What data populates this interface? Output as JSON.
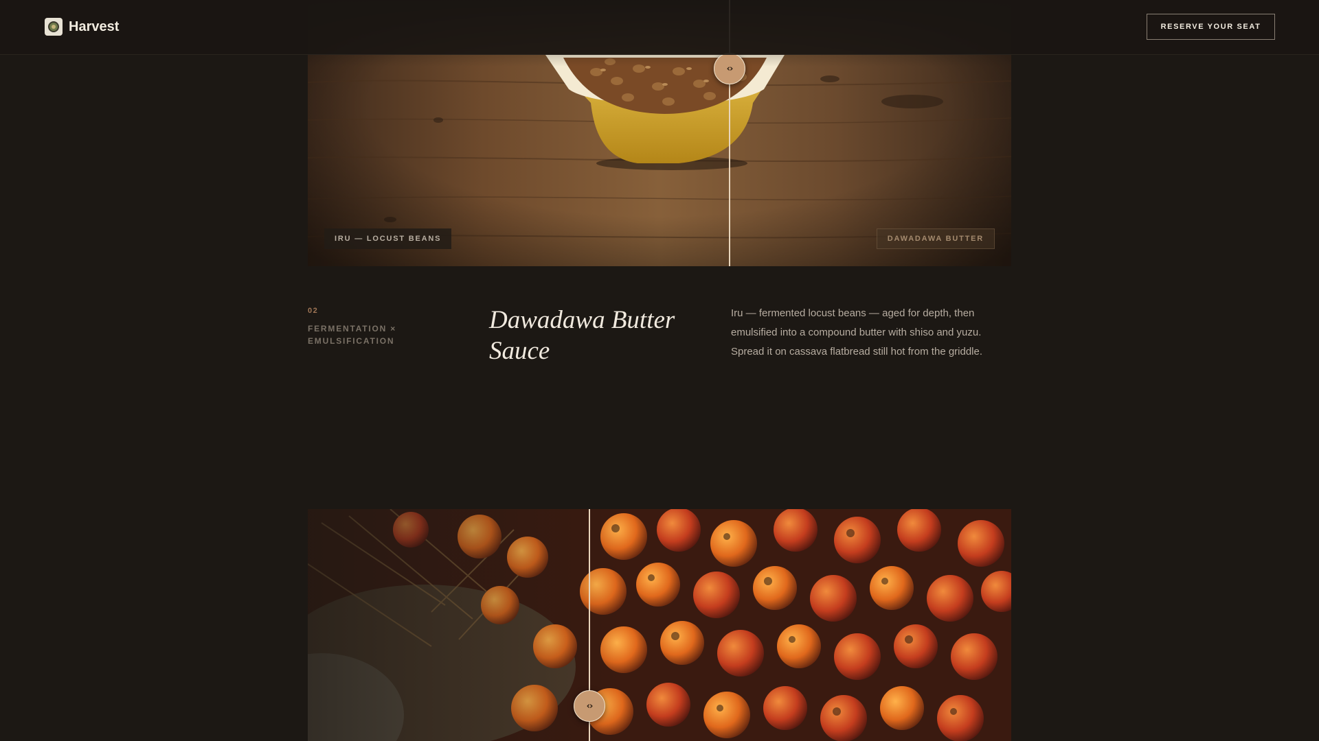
{
  "header": {
    "brand": "Harvest",
    "reserve_label": "RESERVE YOUR SEAT"
  },
  "comparison_1": {
    "before_label": "IRU — LOCUST BEANS",
    "after_label": "DAWADAWA BUTTER",
    "handle_icon": "‹›",
    "split_fraction": 0.6
  },
  "dish": {
    "index": "02",
    "technique": "FERMENTATION × EMULSIFICATION",
    "title": "Dawadawa Butter Sauce",
    "description": "Iru — fermented locust beans — aged for depth, then emulsified into a compound butter with shiso and yuzu. Spread it on cassava flatbread still hot from the griddle."
  },
  "comparison_2": {
    "handle_icon": "‹›",
    "split_fraction": 0.4
  },
  "colors": {
    "background": "#1c1814",
    "accent": "#c79a72",
    "text_primary": "#f1eadf",
    "text_muted": "#7a7166"
  }
}
